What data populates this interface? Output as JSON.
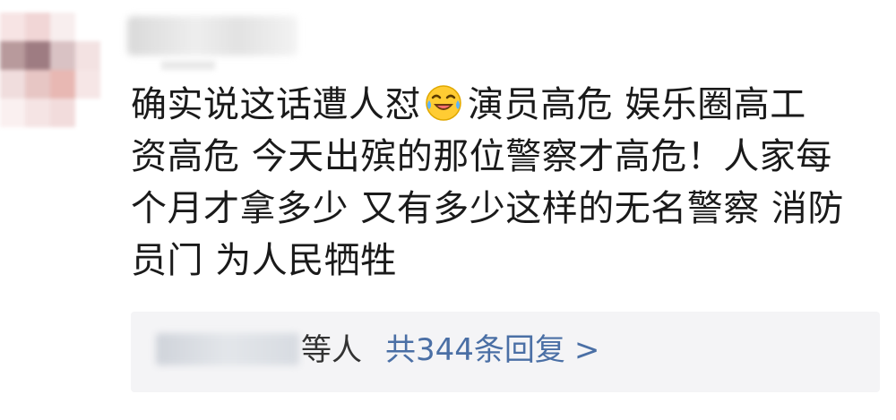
{
  "comment": {
    "lines": [
      [
        "确实说这话遭人怼",
        "演员高危 娱乐圈高工"
      ],
      "资高危 今天出殡的那位警察才高危！人家每",
      "个月才拿多少 又有多少这样的无名警察 消防",
      "员门 为人民牺牲"
    ],
    "emoji": "laughing-crying-emoji"
  },
  "replies": {
    "suffix": "等人",
    "count_label": "共344条回复",
    "chevron": ">"
  },
  "colors": {
    "text": "#1a1a1a",
    "link": "#4a6fa5",
    "reply_bg": "#f4f4f6"
  }
}
